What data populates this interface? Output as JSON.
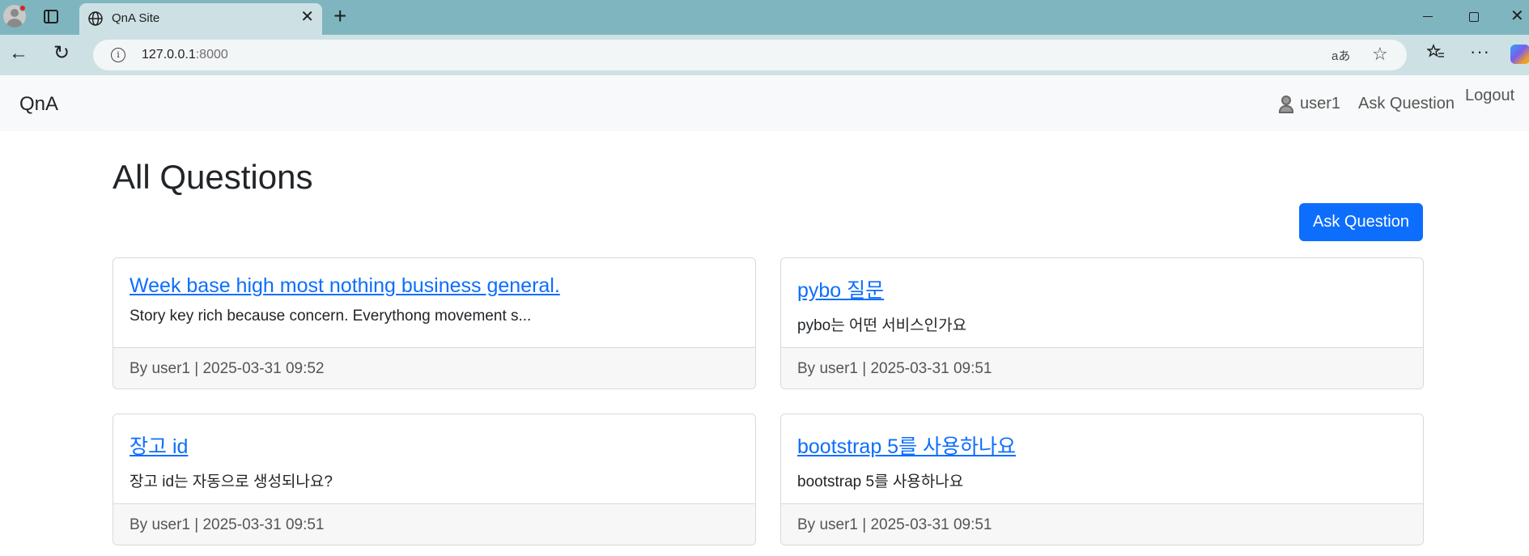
{
  "browser": {
    "tab_title": "QnA Site",
    "tab_close": "✕",
    "new_tab": "+",
    "url_host": "127.0.0.1",
    "url_port": ":8000",
    "read_aloud": "aあ",
    "favorite_star": "☆",
    "more": "···",
    "back": "←",
    "reload": "↻",
    "win_close": "✕"
  },
  "navbar": {
    "brand": "QnA",
    "user": "user1",
    "ask": "Ask Question",
    "logout": "Logout"
  },
  "main": {
    "title": "All Questions",
    "ask_button": "Ask Question",
    "questions": [
      {
        "title": "Week base high most nothing business general.",
        "body": "Story key rich because concern. Everythong movement s...",
        "footer": "By user1 | 2025-03-31 09:52"
      },
      {
        "title": "pybo 질문",
        "body": "pybo는 어떤 서비스인가요",
        "footer": "By user1 | 2025-03-31 09:51"
      },
      {
        "title": "장고 id",
        "body": "장고 id는 자동으로 생성되나요?",
        "footer": "By user1 | 2025-03-31 09:51"
      },
      {
        "title": "bootstrap 5를 사용하나요",
        "body": "bootstrap 5를 사용하나요",
        "footer": "By user1 | 2025-03-31 09:51"
      }
    ]
  },
  "colors": {
    "primary": "#0d6efd",
    "tabbar": "#7fb5be",
    "toolbar": "#cde1e4"
  }
}
